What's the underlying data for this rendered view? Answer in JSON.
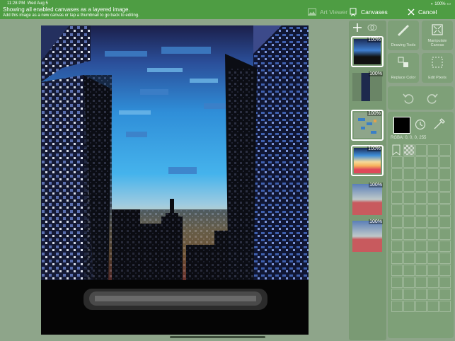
{
  "status": {
    "time": "11:28 PM",
    "date": "Wed Aug 5",
    "battery": "100%"
  },
  "header": {
    "line1": "Showing all enabled canvases as a layered image.",
    "line2": "Add this image as a new canvas or tap a thumbnail to go back to editing.",
    "art_viewer": "Art Viewer",
    "canvases": "Canvases",
    "cancel": "Cancel"
  },
  "thumbnails": [
    {
      "pct": "100%",
      "icon": "city-layer"
    },
    {
      "pct": "100%",
      "icon": "tower-layer"
    },
    {
      "pct": "100%",
      "icon": "clouds-layer"
    },
    {
      "pct": "100%",
      "icon": "sky-gradient-layer"
    },
    {
      "pct": "100%",
      "icon": "small-gradient-layer"
    },
    {
      "pct": "100%",
      "icon": "small-gradient-layer"
    }
  ],
  "tools": {
    "drawing_tools": "Drawing Tools",
    "manipulate_canvas": "Manipulate Canvas",
    "replace_color": "Replace Color",
    "edit_pixels": "Edit Pixels"
  },
  "palette": {
    "current_color": "#000000",
    "rgba": "RGBA: 0, 0, 0, 255"
  }
}
